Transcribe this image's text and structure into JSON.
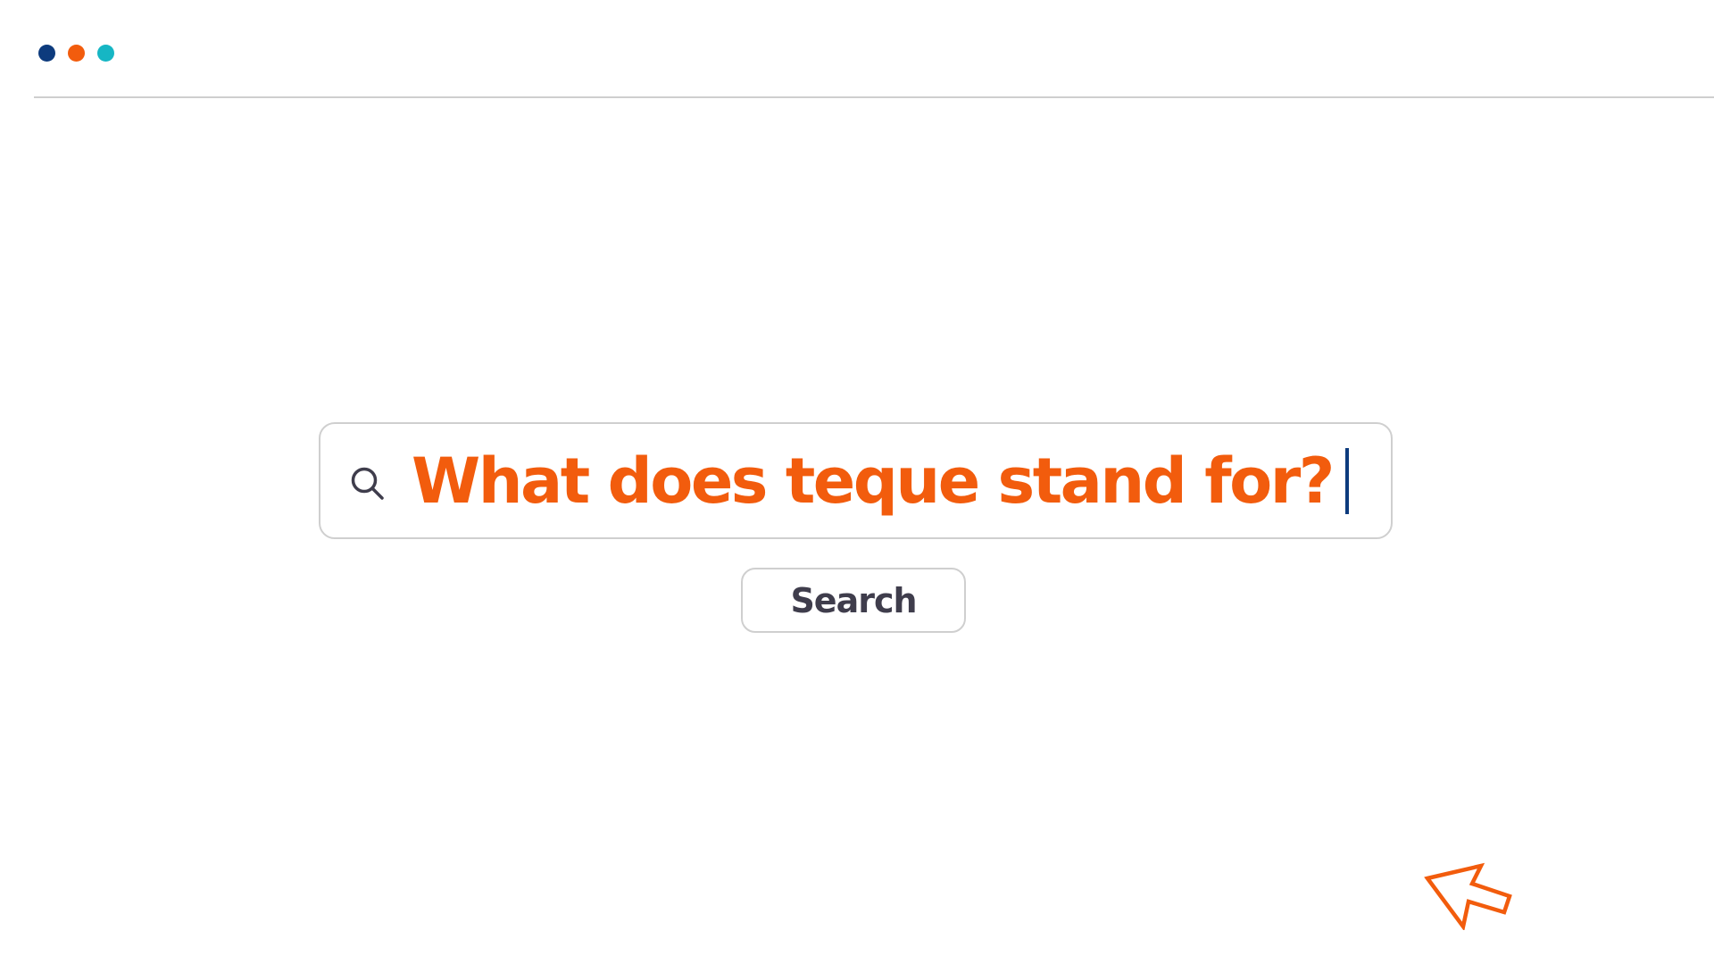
{
  "window": {
    "controls": [
      {
        "name": "window-dot-navy",
        "color": "#0d3b7d"
      },
      {
        "name": "window-dot-orange",
        "color": "#f25c0d"
      },
      {
        "name": "window-dot-teal",
        "color": "#16b6c4"
      }
    ]
  },
  "search": {
    "icon": "search-icon",
    "query": "What does teque stand for?",
    "query_color": "#f25c0d",
    "caret_color": "#0d3b7d",
    "button_label": "Search",
    "button_text_color": "#3f3d4c"
  },
  "pointer": {
    "icon": "mouse-pointer-icon",
    "color": "#f25c0d"
  }
}
